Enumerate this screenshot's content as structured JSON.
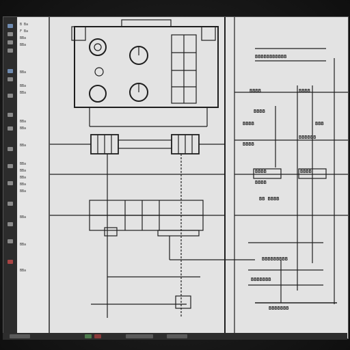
{
  "sidebar": {
    "labels": [
      "B Ba",
      "F Ba",
      "BBa",
      "BBa",
      "BBa",
      "BBa",
      "BBa",
      "BBa",
      "BBa",
      "BBa",
      "BBa",
      "BBa",
      "BBa",
      "BBa",
      "BBa",
      "BBa",
      "BBa",
      "BBa"
    ]
  },
  "drawing": {
    "right_panel": {
      "header_line": "BBBBBBBBBBB",
      "title1": "BBBB",
      "title2": "BBBB",
      "label_a": "BBBB",
      "label_b": "BBBB",
      "label_c": "BBB",
      "label_d": "BBBB",
      "label_e": "BBBBBB",
      "label_f": "BBBB",
      "label_g": "BBBB",
      "label_h": "BBBB",
      "label_i": "BB BBBB",
      "footer1": "BBBBBBBBB",
      "footer2": "BBBBBBB",
      "footer3": "BBBBBBB"
    }
  },
  "colors": {
    "ink": "#1e1e1e",
    "paper": "#e3e3e3",
    "panel": "#e6e6e6"
  }
}
